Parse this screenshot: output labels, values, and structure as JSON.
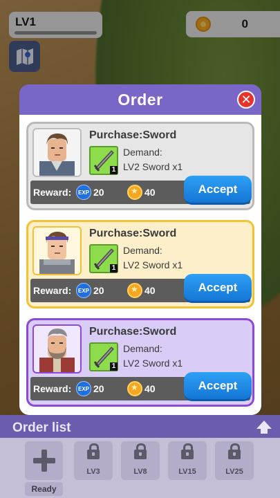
{
  "hud": {
    "level": "LV1",
    "coins": "0"
  },
  "panel": {
    "title": "Order"
  },
  "orders": [
    {
      "title": "Purchase:Sword",
      "item_count": "1",
      "demand_label": "Demand:",
      "demand_value": "LV2 Sword x1",
      "reward_label": "Reward:",
      "exp": "20",
      "gold": "40",
      "accept": "Accept",
      "exp_icon": "EXP"
    },
    {
      "title": "Purchase:Sword",
      "item_count": "1",
      "demand_label": "Demand:",
      "demand_value": "LV2 Sword x1",
      "reward_label": "Reward:",
      "exp": "20",
      "gold": "40",
      "accept": "Accept",
      "exp_icon": "EXP"
    },
    {
      "title": "Purchase:Sword",
      "item_count": "1",
      "demand_label": "Demand:",
      "demand_value": "LV2 Sword x1",
      "reward_label": "Reward:",
      "exp": "20",
      "gold": "40",
      "accept": "Accept",
      "exp_icon": "EXP"
    }
  ],
  "order_list": {
    "title": "Order list",
    "ready_label": "Ready",
    "locked_slots": [
      "LV3",
      "LV8",
      "LV15",
      "LV25"
    ]
  },
  "colors": {
    "panel": "#7a66c7",
    "accept": "#1f8ae6",
    "card_grey": "#e6e6e6",
    "card_yellow": "#fcefc9",
    "card_purple": "#d9ccf7"
  }
}
